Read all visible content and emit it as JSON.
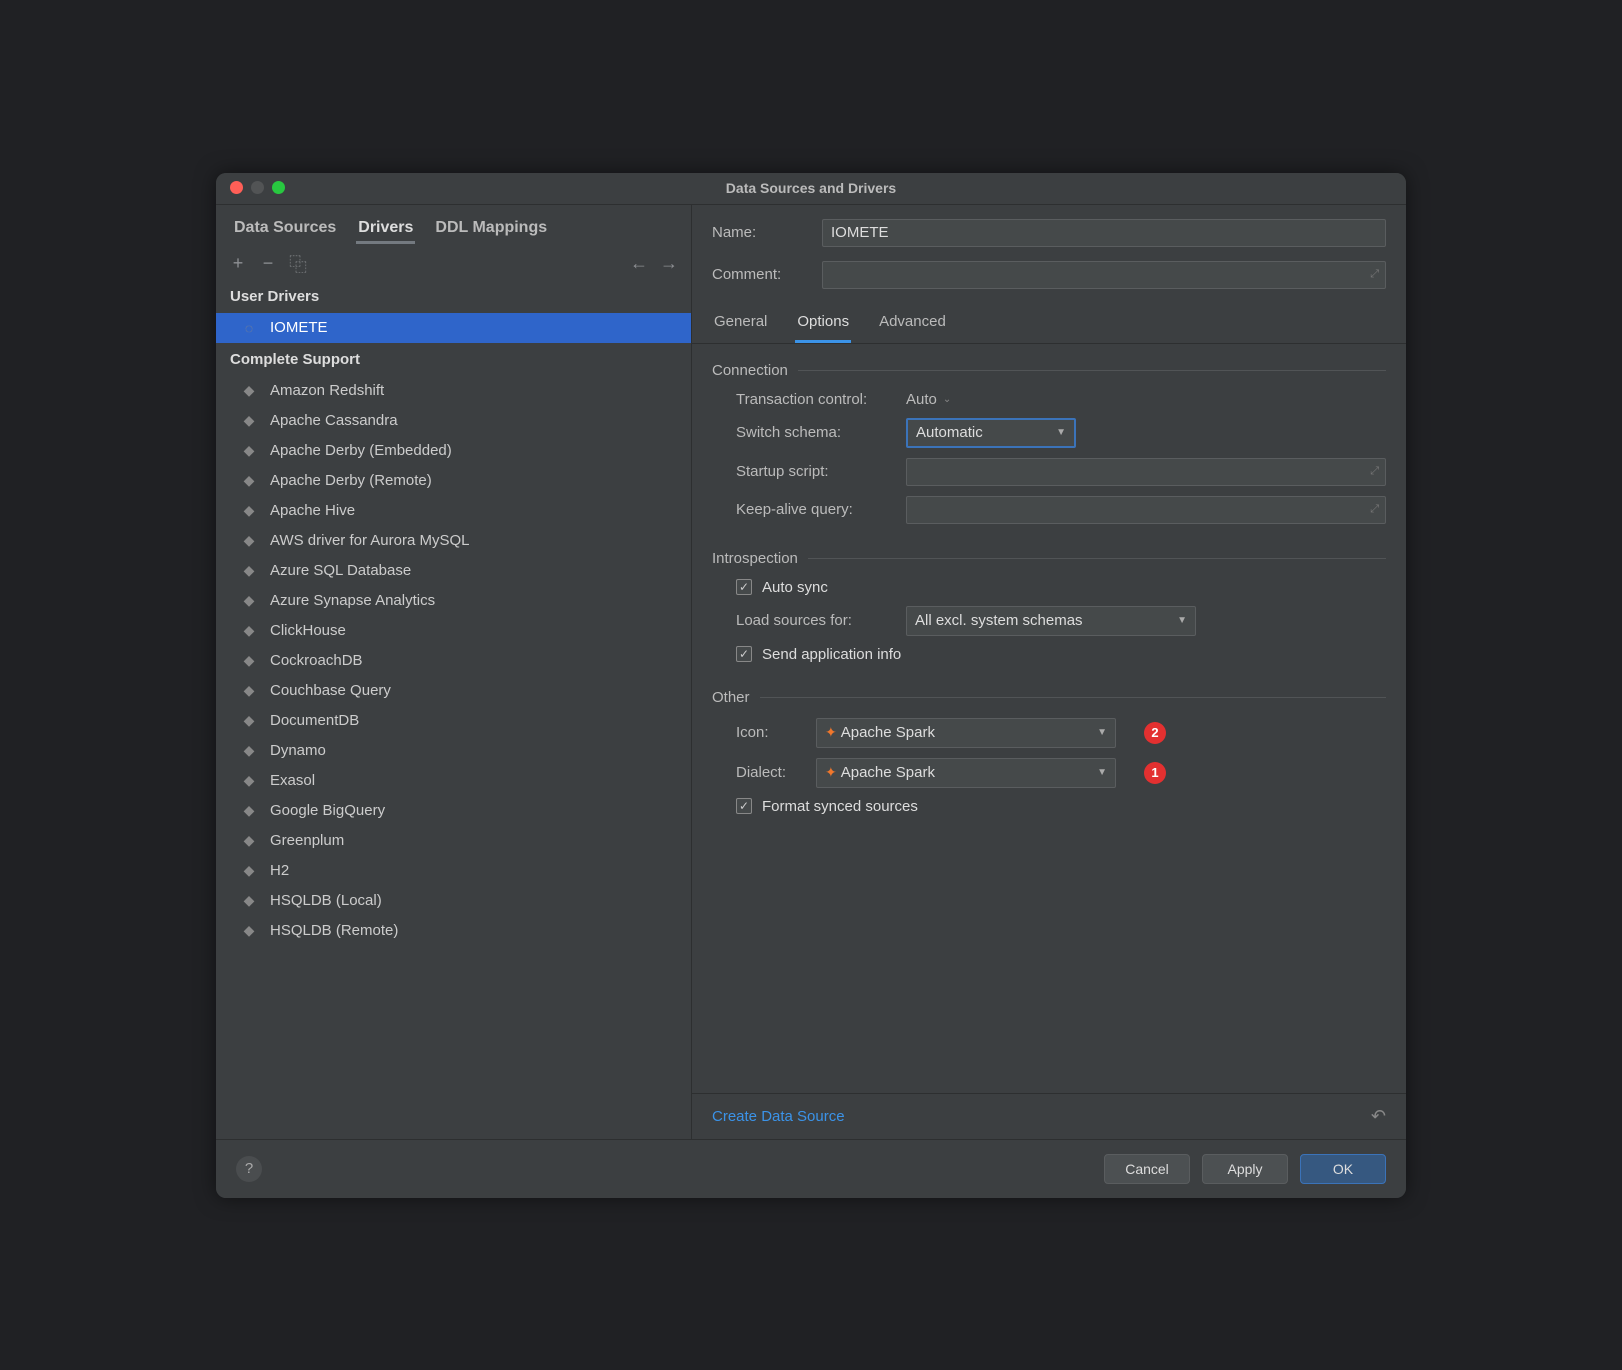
{
  "window": {
    "title": "Data Sources and Drivers"
  },
  "sidetabs": [
    "Data Sources",
    "Drivers",
    "DDL Mappings"
  ],
  "sidetab_active": 1,
  "toolbar": {
    "add": "+",
    "remove": "−",
    "copy": "⿻"
  },
  "tree": {
    "user_header": "User Drivers",
    "user_items": [
      {
        "label": "IOMETE"
      }
    ],
    "complete_header": "Complete Support",
    "complete_items": [
      {
        "label": "Amazon Redshift"
      },
      {
        "label": "Apache Cassandra"
      },
      {
        "label": "Apache Derby (Embedded)"
      },
      {
        "label": "Apache Derby (Remote)"
      },
      {
        "label": "Apache Hive"
      },
      {
        "label": "AWS driver for Aurora MySQL"
      },
      {
        "label": "Azure SQL Database"
      },
      {
        "label": "Azure Synapse Analytics"
      },
      {
        "label": "ClickHouse"
      },
      {
        "label": "CockroachDB"
      },
      {
        "label": "Couchbase Query"
      },
      {
        "label": "DocumentDB"
      },
      {
        "label": "Dynamo"
      },
      {
        "label": "Exasol"
      },
      {
        "label": "Google BigQuery"
      },
      {
        "label": "Greenplum"
      },
      {
        "label": "H2"
      },
      {
        "label": "HSQLDB (Local)"
      },
      {
        "label": "HSQLDB (Remote)"
      }
    ]
  },
  "form": {
    "name_label": "Name:",
    "name_value": "IOMETE",
    "comment_label": "Comment:",
    "comment_value": ""
  },
  "maintabs": [
    "General",
    "Options",
    "Advanced"
  ],
  "maintab_active": 1,
  "sections": {
    "connection": {
      "title": "Connection",
      "tx_label": "Transaction control:",
      "tx_value": "Auto",
      "schema_label": "Switch schema:",
      "schema_value": "Automatic",
      "startup_label": "Startup script:",
      "startup_value": "",
      "keepalive_label": "Keep-alive query:",
      "keepalive_value": ""
    },
    "introspection": {
      "title": "Introspection",
      "autosync": "Auto sync",
      "load_label": "Load sources for:",
      "load_value": "All excl. system schemas",
      "sendinfo": "Send application info"
    },
    "other": {
      "title": "Other",
      "icon_label": "Icon:",
      "icon_value": "Apache Spark",
      "dialect_label": "Dialect:",
      "dialect_value": "Apache Spark",
      "format": "Format synced sources",
      "badge_icon": "2",
      "badge_dialect": "1"
    }
  },
  "footer": {
    "link": "Create Data Source"
  },
  "buttons": {
    "cancel": "Cancel",
    "apply": "Apply",
    "ok": "OK"
  }
}
